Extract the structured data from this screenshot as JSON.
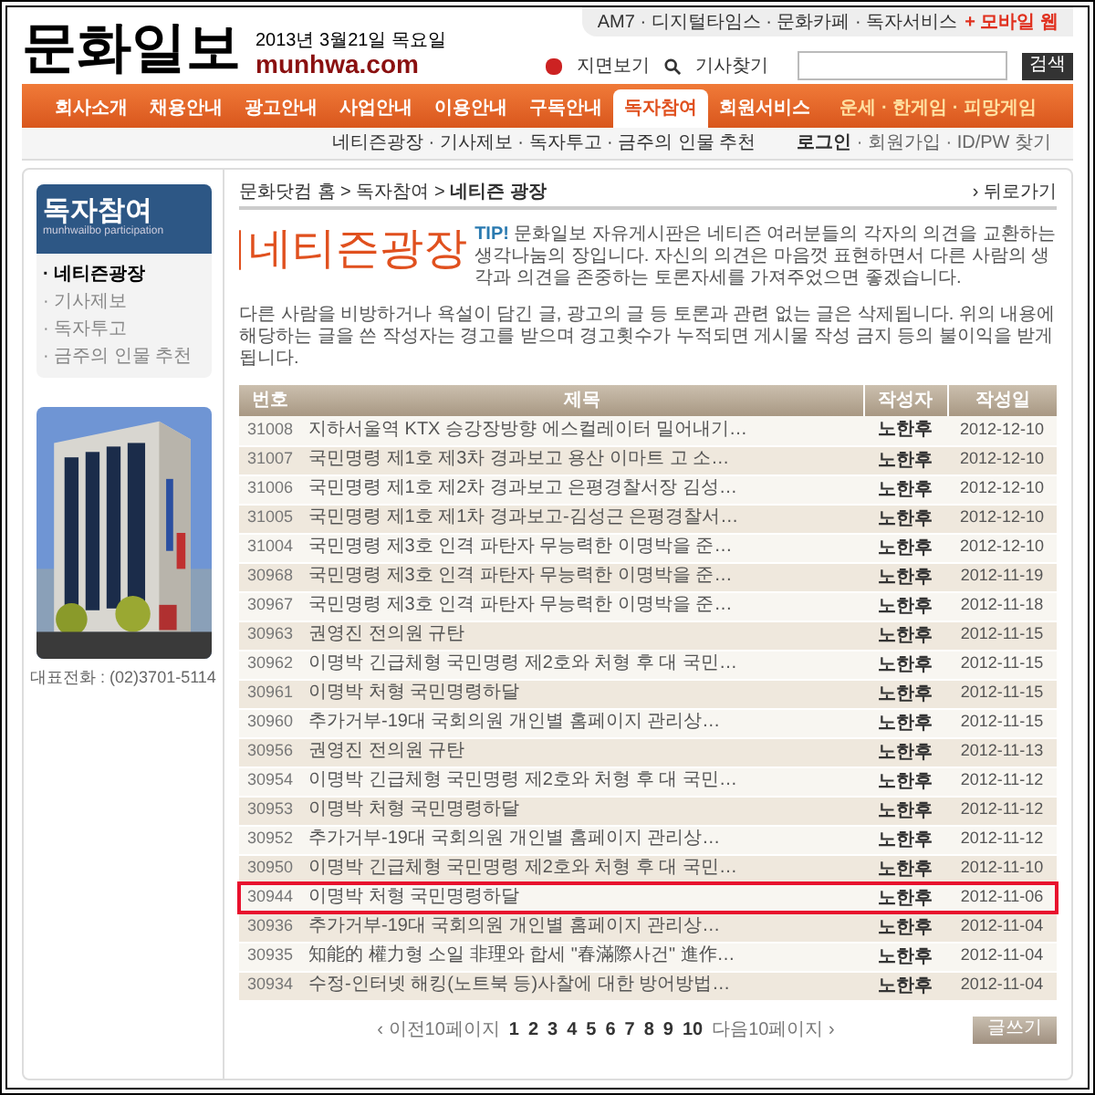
{
  "top_links": {
    "text": "AM7 · 디지털타임스 · 문화카페 · 독자서비스",
    "mobile": "+ 모바일 웹"
  },
  "logo": {
    "name": "문화일보",
    "date": "2013년 3월21일 목요일",
    "domain": "munhwa.com"
  },
  "tools": {
    "paper": "지면보기",
    "find": "기사찾기",
    "search_button": "검색"
  },
  "nav": [
    {
      "label": "회사소개",
      "selected": false
    },
    {
      "label": "채용안내",
      "selected": false
    },
    {
      "label": "광고안내",
      "selected": false
    },
    {
      "label": "사업안내",
      "selected": false
    },
    {
      "label": "이용안내",
      "selected": false
    },
    {
      "label": "구독안내",
      "selected": false
    },
    {
      "label": "독자참여",
      "selected": true
    },
    {
      "label": "회원서비스",
      "selected": false
    }
  ],
  "nav_right": "운세 · 한게임 · 피망게임",
  "subnav": "네티즌광장 · 기사제보 · 독자투고 · 금주의 인물 추천",
  "account": {
    "login": "로그인",
    "rest": " · 회원가입 · ID/PW 찾기"
  },
  "sidebar": {
    "title": "독자참여",
    "subtitle": "munhwailbo participation",
    "items": [
      {
        "label": "· 네티즌광장",
        "selected": true
      },
      {
        "label": "· 기사제보",
        "selected": false
      },
      {
        "label": "· 독자투고",
        "selected": false
      },
      {
        "label": "· 금주의 인물 추천",
        "selected": false
      }
    ],
    "phone": "대표전화 : (02)3701-5114"
  },
  "breadcrumb": {
    "path": "문화닷컴 홈 > 독자참여 > ",
    "current": "네티즌 광장",
    "back": "› 뒤로가기"
  },
  "heading": "네티즌광장",
  "tip": {
    "label": "TIP!",
    "text": "문화일보 자유게시판은 네티즌 여러분들의 각자의 의견을 교환하는 생각나눔의 장입니다. 자신의 의견은 마음껏 표현하면서 다른 사람의 생각과 의견을 존중하는 토론자세를 가져주었으면 좋겠습니다."
  },
  "notice": "다른 사람을 비방하거나 욕설이 담긴 글, 광고의 글 등 토론과 관련 없는 글은 삭제됩니다. 위의 내용에 해당하는 글을 쓴 작성자는 경고를 받으며 경고횟수가 누적되면 게시물 작성 금지 등의 불이익을 받게 됩니다.",
  "table": {
    "columns": [
      "번호",
      "제목",
      "작성자",
      "작성일"
    ],
    "rows": [
      {
        "no": "31008",
        "title": "지하서울역 KTX 승강장방향 에스컬레이터 밀어내기…",
        "author": "노한후",
        "date": "2012-12-10",
        "highlighted": false
      },
      {
        "no": "31007",
        "title": "국민명령 제1호 제3차 경과보고 용산 이마트 고 소…",
        "author": "노한후",
        "date": "2012-12-10",
        "highlighted": false
      },
      {
        "no": "31006",
        "title": "국민명령 제1호 제2차 경과보고 은평경찰서장 김성…",
        "author": "노한후",
        "date": "2012-12-10",
        "highlighted": false
      },
      {
        "no": "31005",
        "title": "국민명령 제1호 제1차 경과보고-김성근 은평경찰서…",
        "author": "노한후",
        "date": "2012-12-10",
        "highlighted": false
      },
      {
        "no": "31004",
        "title": "국민명령 제3호 인격 파탄자 무능력한 이명박을 준…",
        "author": "노한후",
        "date": "2012-12-10",
        "highlighted": false
      },
      {
        "no": "30968",
        "title": "국민명령 제3호 인격 파탄자 무능력한 이명박을 준…",
        "author": "노한후",
        "date": "2012-11-19",
        "highlighted": false
      },
      {
        "no": "30967",
        "title": "국민명령 제3호 인격 파탄자 무능력한 이명박을 준…",
        "author": "노한후",
        "date": "2012-11-18",
        "highlighted": false
      },
      {
        "no": "30963",
        "title": "권영진 전의원 규탄",
        "author": "노한후",
        "date": "2012-11-15",
        "highlighted": false
      },
      {
        "no": "30962",
        "title": "이명박 긴급체형 국민명령 제2호와 처형 후 대 국민…",
        "author": "노한후",
        "date": "2012-11-15",
        "highlighted": false
      },
      {
        "no": "30961",
        "title": "이명박 처형 국민명령하달",
        "author": "노한후",
        "date": "2012-11-15",
        "highlighted": false
      },
      {
        "no": "30960",
        "title": "추가거부-19대 국회의원 개인별 홈페이지 관리상…",
        "author": "노한후",
        "date": "2012-11-15",
        "highlighted": false
      },
      {
        "no": "30956",
        "title": "권영진 전의원 규탄",
        "author": "노한후",
        "date": "2012-11-13",
        "highlighted": false
      },
      {
        "no": "30954",
        "title": "이명박 긴급체형 국민명령 제2호와 처형 후 대 국민…",
        "author": "노한후",
        "date": "2012-11-12",
        "highlighted": false
      },
      {
        "no": "30953",
        "title": "이명박 처형 국민명령하달",
        "author": "노한후",
        "date": "2012-11-12",
        "highlighted": false
      },
      {
        "no": "30952",
        "title": "추가거부-19대 국회의원 개인별 홈페이지 관리상…",
        "author": "노한후",
        "date": "2012-11-12",
        "highlighted": false
      },
      {
        "no": "30950",
        "title": "이명박 긴급체형 국민명령 제2호와 처형 후 대 국민…",
        "author": "노한후",
        "date": "2012-11-10",
        "highlighted": false
      },
      {
        "no": "30944",
        "title": "이명박 처형 국민명령하달",
        "author": "노한후",
        "date": "2012-11-06",
        "highlighted": true
      },
      {
        "no": "30936",
        "title": "추가거부-19대 국회의원 개인별 홈페이지 관리상…",
        "author": "노한후",
        "date": "2012-11-04",
        "highlighted": false
      },
      {
        "no": "30935",
        "title": "知能的 權力형 소일 非理와 합세 \"春滿際사건\" 進作…",
        "author": "노한후",
        "date": "2012-11-04",
        "highlighted": false
      },
      {
        "no": "30934",
        "title": "수정-인터넷 해킹(노트북 등)사찰에 대한 방어방법…",
        "author": "노한후",
        "date": "2012-11-04",
        "highlighted": false
      }
    ]
  },
  "pagination": {
    "prev": "‹ 이전10페이지",
    "pages": [
      "1",
      "2",
      "3",
      "4",
      "5",
      "6",
      "7",
      "8",
      "9",
      "10"
    ],
    "next": "다음10페이지 ›"
  },
  "write_button": "글쓰기"
}
